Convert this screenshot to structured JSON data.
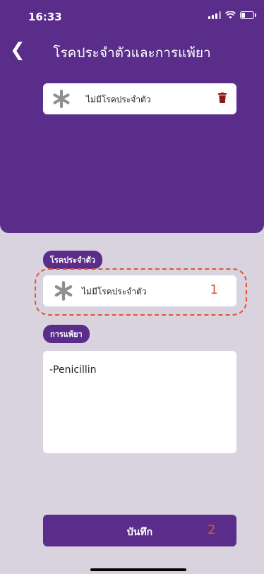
{
  "status_bar": {
    "time": "16:33"
  },
  "header": {
    "title": "โรคประจำตัวและการแพ้ยา"
  },
  "top_card": {
    "text": "ไม่มีโรคประจำตัว"
  },
  "section_disease": {
    "label": "โรคประจำตัว"
  },
  "disease_card": {
    "text": "ไม่มีโรคประจำตัว",
    "annotation": "1"
  },
  "section_allergy": {
    "label": "การแพ้ยา"
  },
  "allergy": {
    "value": "-Penicillin"
  },
  "save": {
    "label": "บันทึก",
    "annotation": "2"
  },
  "colors": {
    "primary": "#5a2d8a",
    "accent": "#e0552f",
    "background": "#d8d3de"
  }
}
